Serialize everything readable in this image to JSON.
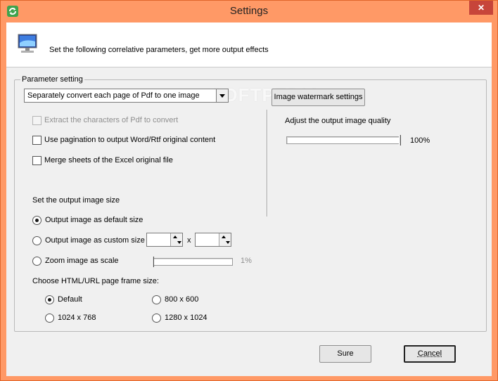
{
  "window": {
    "title": "Settings",
    "close_glyph": "✕"
  },
  "header": {
    "description": "Set the following correlative parameters, get more output effects",
    "icon": "monitor-icon"
  },
  "group": {
    "legend": "Parameter setting"
  },
  "convert_mode": {
    "selected": "Separately convert each page of Pdf to one image"
  },
  "buttons": {
    "watermark": "Image watermark settings",
    "sure": "Sure",
    "cancel": "Cancel"
  },
  "options": {
    "extract_chars": {
      "label": "Extract the characters of Pdf to convert",
      "checked": false,
      "disabled": true
    },
    "pagination": {
      "label": "Use pagination to output Word/Rtf original content",
      "checked": false
    },
    "merge_excel": {
      "label": "Merge sheets of the Excel original file",
      "checked": false
    }
  },
  "output_size": {
    "heading": "Set the output image size",
    "default_label": "Output image as default size",
    "custom_label": "Output image as custom size",
    "custom_width": "",
    "custom_height": "",
    "times": "x",
    "zoom_label": "Zoom image as scale",
    "zoom_value": "1%",
    "selected": "default"
  },
  "frame_size": {
    "heading": "Choose HTML/URL page frame size:",
    "options": [
      "Default",
      "800 x 600",
      "1024 x 768",
      "1280 x 1024"
    ],
    "selected": "Default"
  },
  "quality": {
    "label": "Adjust the output image quality",
    "value": "100%",
    "level": 1.0
  },
  "watermark_text": "SOFTPEDIA",
  "colors": {
    "title_bar": "#ff9966",
    "close": "#c7453a",
    "dialog": "#f0f0f0"
  }
}
